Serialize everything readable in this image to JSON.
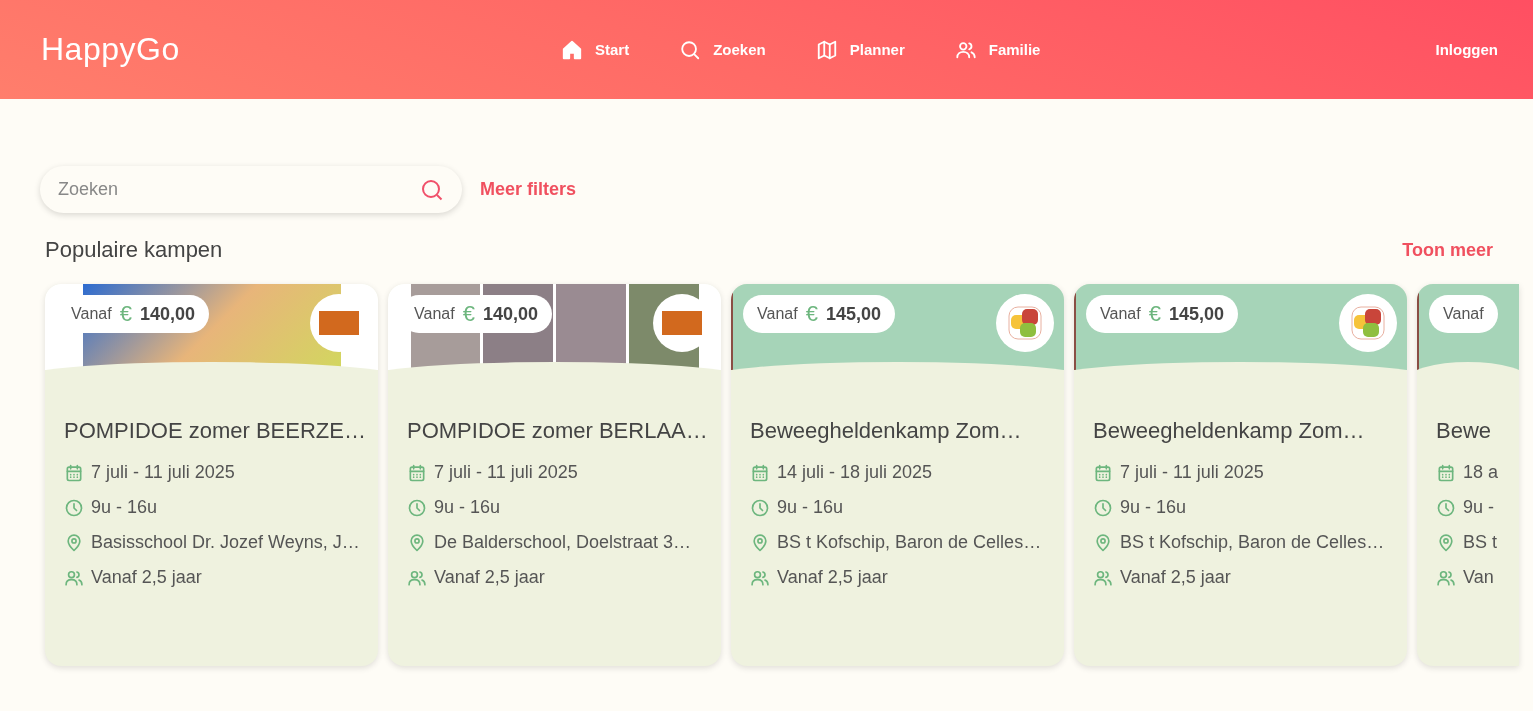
{
  "header": {
    "logo": "HappyGo",
    "nav": [
      {
        "label": "Start",
        "kind": "home"
      },
      {
        "label": "Zoeken",
        "kind": "search"
      },
      {
        "label": "Planner",
        "kind": "map"
      },
      {
        "label": "Familie",
        "kind": "users"
      }
    ],
    "login": "Inloggen"
  },
  "search": {
    "placeholder": "Zoeken",
    "more_filters": "Meer filters"
  },
  "section": {
    "title": "Populaire kampen",
    "show_more": "Toon meer"
  },
  "camps": [
    {
      "price_label": "Vanaf",
      "currency": "€",
      "price": "140,00",
      "kind": "photo",
      "title": "POMPIDOE zomer BEERZE…",
      "dates": "7 juli - 11 juli 2025",
      "hours": "9u - 16u",
      "location": "Basisschool Dr. Jozef Weyns, J…",
      "age": "Vanaf 2,5 jaar"
    },
    {
      "price_label": "Vanaf",
      "currency": "€",
      "price": "140,00",
      "kind": "collage",
      "title": "POMPIDOE zomer BERLAA…",
      "dates": "7 juli - 11 juli 2025",
      "hours": "9u - 16u",
      "location": "De Balderschool, Doelstraat 3…",
      "age": "Vanaf 2,5 jaar"
    },
    {
      "price_label": "Vanaf",
      "currency": "€",
      "price": "145,00",
      "kind": "illustration",
      "title": "Beweegheldenkamp Zom…",
      "dates": "14 juli - 18 juli 2025",
      "hours": "9u - 16u",
      "location": "BS t Kofschip, Baron de Celles…",
      "age": "Vanaf 2,5 jaar"
    },
    {
      "price_label": "Vanaf",
      "currency": "€",
      "price": "145,00",
      "kind": "illustration",
      "title": "Beweegheldenkamp Zom…",
      "dates": "7 juli - 11 juli 2025",
      "hours": "9u - 16u",
      "location": "BS t Kofschip, Baron de Celles…",
      "age": "Vanaf 2,5 jaar"
    },
    {
      "price_label": "Vanaf",
      "kind": "illustration",
      "title": "Bewe",
      "dates": "18 a",
      "hours": "9u -",
      "location": "BS t",
      "age": "Van"
    }
  ]
}
